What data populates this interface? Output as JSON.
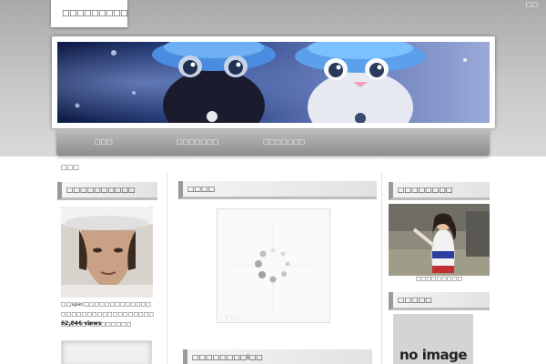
{
  "header": {
    "site_title": "□□□□□□□□□",
    "top_link": "□□"
  },
  "nav": {
    "items": [
      {
        "label": "□□□"
      },
      {
        "label": "□□□□□□□"
      },
      {
        "label": "□□□□□□□"
      }
    ]
  },
  "breadcrumb": {
    "label": "□□□"
  },
  "left_sidebar": {
    "widget_title": "□□□□□□□□□□",
    "post": {
      "description": "□□spec□□□□□□□□□□□□□□□□□□□□□□□□□□□□□□□□□□□□3□□□□□□□□",
      "views": "62,846 views"
    }
  },
  "main": {
    "section1_title": "□□□□",
    "section2_title": "□□□□□□□□l□□"
  },
  "right_sidebar": {
    "widget1_title": "□□□□□□□□",
    "photo_caption": "□□□□□□□□□",
    "widget2_title": "□□□□□",
    "no_image_text": "no image"
  }
}
